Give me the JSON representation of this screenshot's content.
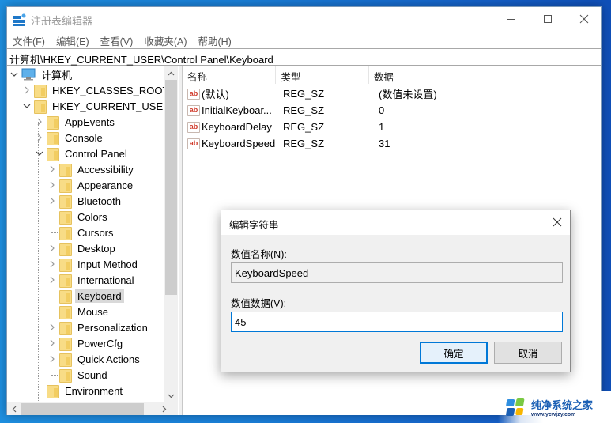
{
  "window": {
    "title": "注册表编辑器",
    "controls": {
      "minimize": "minimize",
      "maximize": "maximize",
      "close": "close"
    }
  },
  "menu": [
    "文件(F)",
    "编辑(E)",
    "查看(V)",
    "收藏夹(A)",
    "帮助(H)"
  ],
  "address_bar": "计算机\\HKEY_CURRENT_USER\\Control Panel\\Keyboard",
  "tree": {
    "root": "计算机",
    "nodes": [
      {
        "label": "HKEY_CLASSES_ROOT",
        "level": 1,
        "expander": "collapsed"
      },
      {
        "label": "HKEY_CURRENT_USER",
        "level": 1,
        "expander": "expanded"
      },
      {
        "label": "AppEvents",
        "level": 2,
        "expander": "collapsed"
      },
      {
        "label": "Console",
        "level": 2,
        "expander": "collapsed"
      },
      {
        "label": "Control Panel",
        "level": 2,
        "expander": "expanded"
      },
      {
        "label": "Accessibility",
        "level": 3,
        "expander": "collapsed"
      },
      {
        "label": "Appearance",
        "level": 3,
        "expander": "collapsed"
      },
      {
        "label": "Bluetooth",
        "level": 3,
        "expander": "collapsed"
      },
      {
        "label": "Colors",
        "level": 3,
        "expander": "none"
      },
      {
        "label": "Cursors",
        "level": 3,
        "expander": "none"
      },
      {
        "label": "Desktop",
        "level": 3,
        "expander": "collapsed"
      },
      {
        "label": "Input Method",
        "level": 3,
        "expander": "collapsed"
      },
      {
        "label": "International",
        "level": 3,
        "expander": "collapsed"
      },
      {
        "label": "Keyboard",
        "level": 3,
        "expander": "none",
        "selected": true
      },
      {
        "label": "Mouse",
        "level": 3,
        "expander": "none"
      },
      {
        "label": "Personalization",
        "level": 3,
        "expander": "collapsed"
      },
      {
        "label": "PowerCfg",
        "level": 3,
        "expander": "collapsed"
      },
      {
        "label": "Quick Actions",
        "level": 3,
        "expander": "collapsed"
      },
      {
        "label": "Sound",
        "level": 3,
        "expander": "none"
      },
      {
        "label": "Environment",
        "level": 2,
        "expander": "none"
      }
    ]
  },
  "list": {
    "columns": [
      "名称",
      "类型",
      "数据"
    ],
    "rows": [
      {
        "name": "(默认)",
        "type": "REG_SZ",
        "data": "(数值未设置)"
      },
      {
        "name": "InitialKeyboar...",
        "type": "REG_SZ",
        "data": "0"
      },
      {
        "name": "KeyboardDelay",
        "type": "REG_SZ",
        "data": "1"
      },
      {
        "name": "KeyboardSpeed",
        "type": "REG_SZ",
        "data": "31"
      }
    ]
  },
  "dialog": {
    "title": "编辑字符串",
    "name_label": "数值名称(N):",
    "name_value": "KeyboardSpeed",
    "data_label": "数值数据(V):",
    "data_value": "45",
    "ok_label": "确定",
    "cancel_label": "取消"
  },
  "watermark": {
    "title": "纯净系统之家",
    "url": "www.ycwjzy.com"
  },
  "colors": {
    "accent": "#0078d7",
    "folder": "#f8dc86",
    "selected_bg": "#d9d9d9",
    "desktop": "#1a7fd8"
  }
}
